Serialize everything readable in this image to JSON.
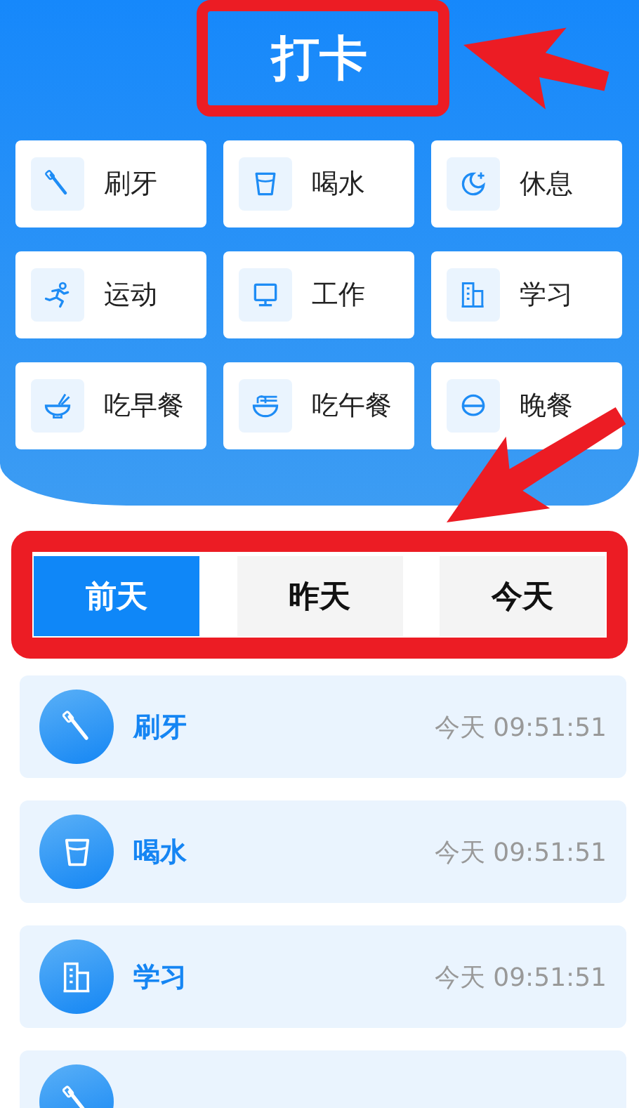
{
  "title": "打卡",
  "activities": [
    {
      "label": "刷牙",
      "kind": "toothbrush"
    },
    {
      "label": "喝水",
      "kind": "cup"
    },
    {
      "label": "休息",
      "kind": "moon"
    },
    {
      "label": "运动",
      "kind": "runner"
    },
    {
      "label": "工作",
      "kind": "monitor"
    },
    {
      "label": "学习",
      "kind": "building"
    },
    {
      "label": "吃早餐",
      "kind": "bowl"
    },
    {
      "label": "吃午餐",
      "kind": "noodles"
    },
    {
      "label": "晚餐",
      "kind": "rice"
    }
  ],
  "tabs": [
    {
      "label": "前天",
      "selected": true
    },
    {
      "label": "昨天",
      "selected": false
    },
    {
      "label": "今天",
      "selected": false
    }
  ],
  "records": [
    {
      "name": "刷牙",
      "kind": "toothbrush",
      "time": "今天 09:51:51"
    },
    {
      "name": "喝水",
      "kind": "cup",
      "time": "今天 09:51:51"
    },
    {
      "name": "学习",
      "kind": "building",
      "time": "今天 09:51:51"
    },
    {
      "kind": "toothbrush"
    }
  ]
}
